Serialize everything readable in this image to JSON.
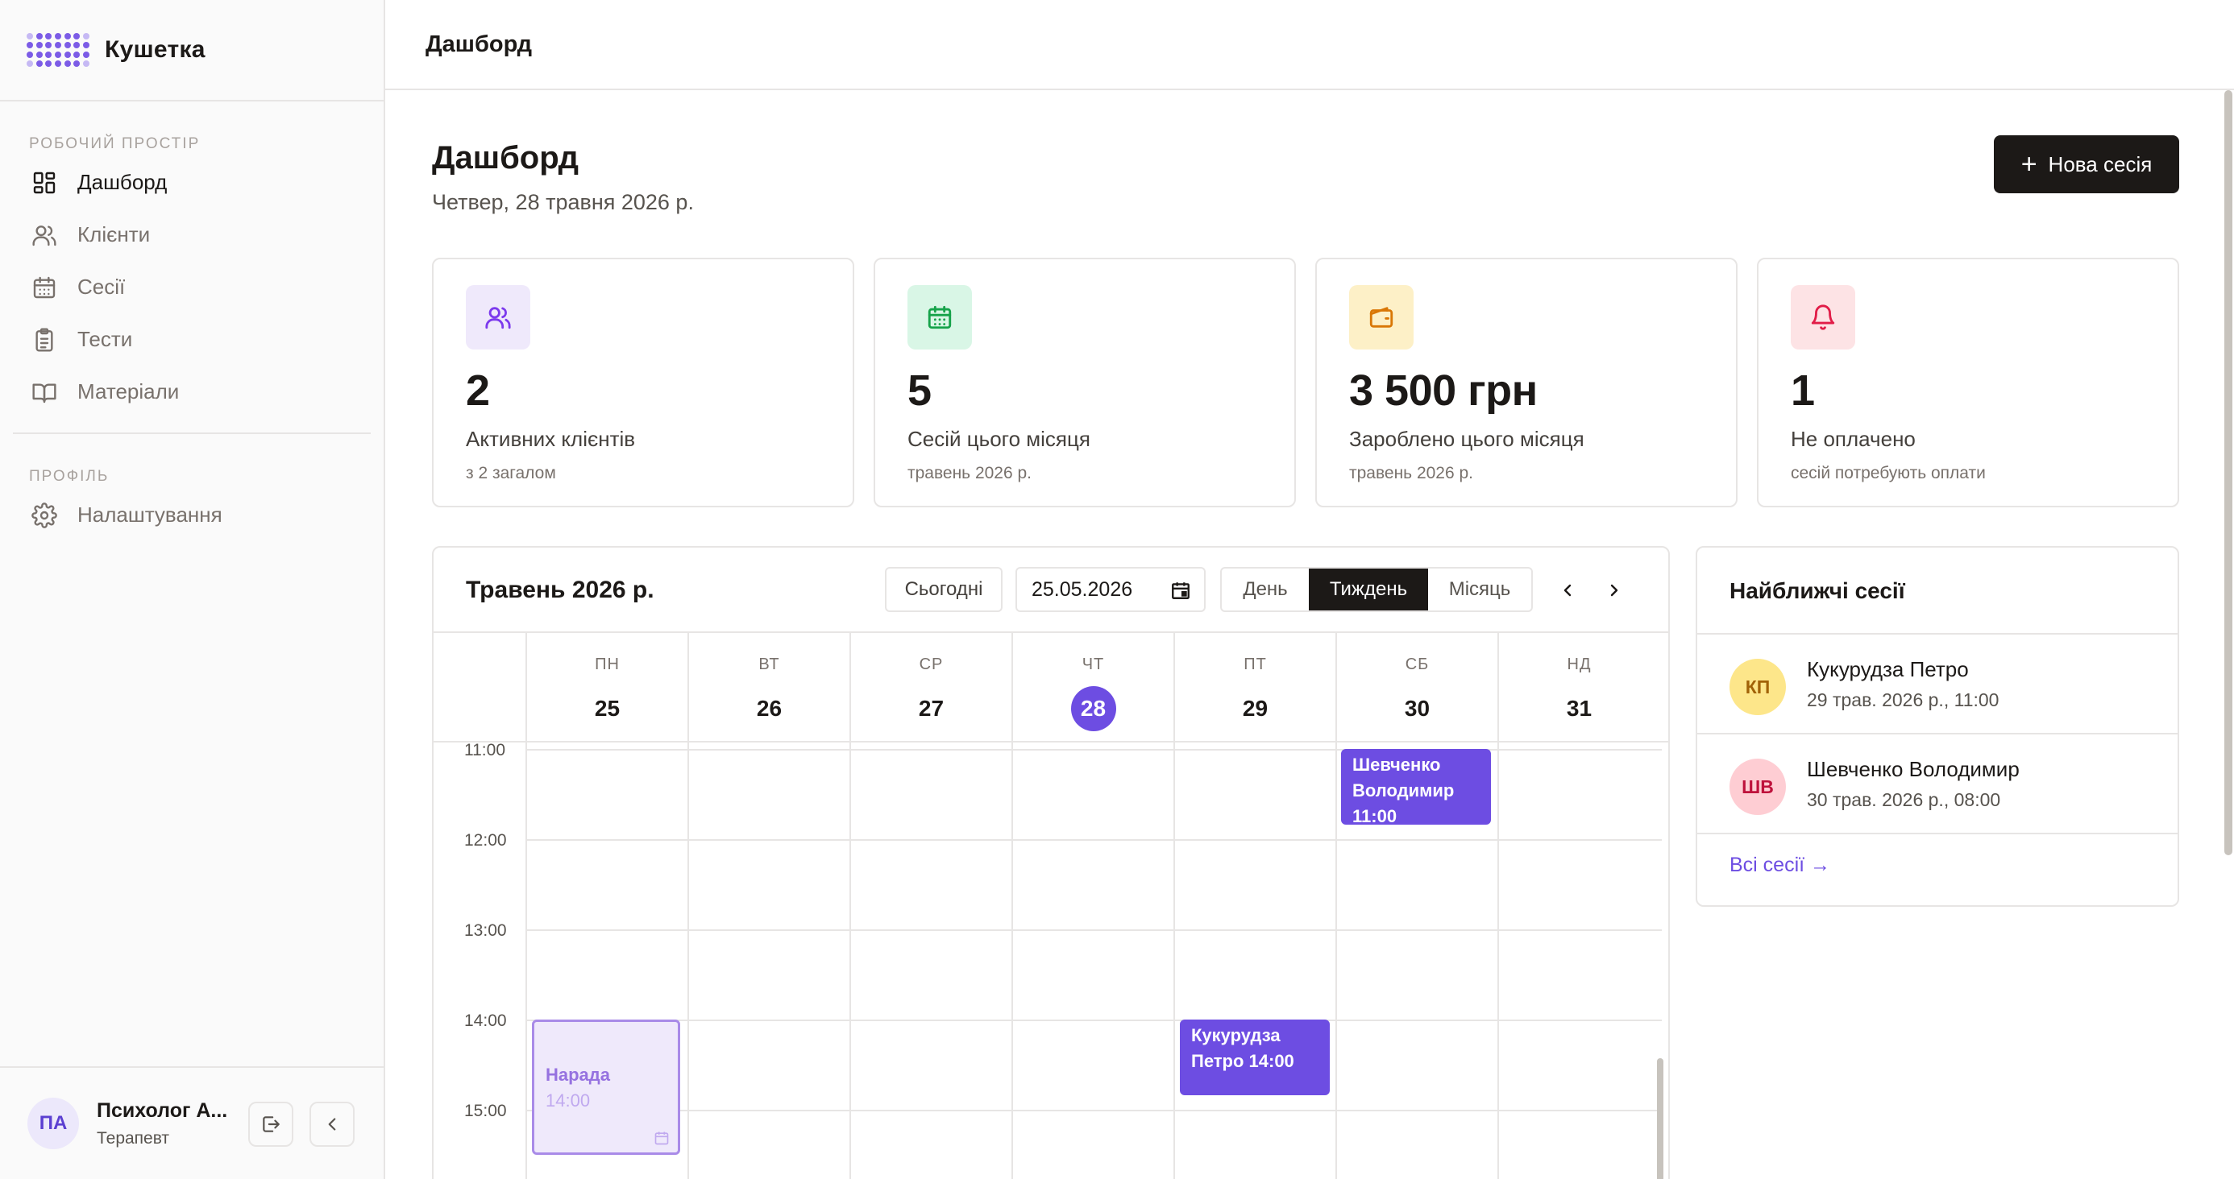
{
  "brand": {
    "name": "Кушетка"
  },
  "sidebar": {
    "workspace_label": "РОБОЧИЙ ПРОСТІР",
    "items": [
      {
        "label": "Дашборд",
        "icon": "grid-icon"
      },
      {
        "label": "Клієнти",
        "icon": "users-icon"
      },
      {
        "label": "Сесії",
        "icon": "calendar-icon"
      },
      {
        "label": "Тести",
        "icon": "clipboard-icon"
      },
      {
        "label": "Матеріали",
        "icon": "book-icon"
      }
    ],
    "profile_label": "ПРОФІЛЬ",
    "settings_label": "Налаштування"
  },
  "user": {
    "initials": "ПА",
    "name": "Психолог А...",
    "role": "Терапевт"
  },
  "topbar": {
    "title": "Дашборд"
  },
  "page": {
    "title": "Дашборд",
    "date": "Четвер, 28 травня 2026 р.",
    "new_session": "Нова сесія"
  },
  "stats": [
    {
      "value": "2",
      "label": "Активних клієнтів",
      "sub": "з 2 загалом"
    },
    {
      "value": "5",
      "label": "Сесій цього місяця",
      "sub": "травень 2026 р."
    },
    {
      "value": "3 500 грн",
      "label": "Зароблено цього місяця",
      "sub": "травень 2026 р."
    },
    {
      "value": "1",
      "label": "Не оплачено",
      "sub": "сесій потребують оплати"
    }
  ],
  "calendar": {
    "title": "Травень 2026 р.",
    "today_btn": "Сьогодні",
    "date_value": "25.05.2026",
    "views": [
      "День",
      "Тиждень",
      "Місяць"
    ],
    "active_view": "Тиждень",
    "days": [
      {
        "name": "ПН",
        "num": "25"
      },
      {
        "name": "ВТ",
        "num": "26"
      },
      {
        "name": "СР",
        "num": "27"
      },
      {
        "name": "ЧТ",
        "num": "28"
      },
      {
        "name": "ПТ",
        "num": "29"
      },
      {
        "name": "СБ",
        "num": "30"
      },
      {
        "name": "НД",
        "num": "31"
      }
    ],
    "hours": [
      "11:00",
      "12:00",
      "13:00",
      "14:00",
      "15:00"
    ],
    "events": {
      "shevchenko": {
        "line1": "Шевченко",
        "line2": "Володимир",
        "time": "11:00"
      },
      "kukurudza": {
        "line1": "Кукурудза",
        "line2": "Петро 14:00"
      },
      "narada": {
        "title": "Нарада",
        "time": "14:00"
      }
    }
  },
  "upcoming": {
    "title": "Найближчі сесії",
    "items": [
      {
        "initials": "КП",
        "name": "Кукурудза Петро",
        "when": "29 трав. 2026 р., 11:00"
      },
      {
        "initials": "ШВ",
        "name": "Шевченко Володимир",
        "when": "30 трав. 2026 р., 08:00"
      }
    ],
    "all_link": "Всі сесії →"
  },
  "colors": {
    "accent": "#6d4de2",
    "stat_icon_bg": [
      "#efe9fb",
      "#d9f6e6",
      "#fdf0c7",
      "#fde3e5"
    ],
    "stat_icon_fg": [
      "#7c3aed",
      "#16a34a",
      "#d97706",
      "#e11d48"
    ],
    "upcoming_avatar_bg": [
      "#fde68a",
      "#fecdd3"
    ],
    "upcoming_avatar_fg": [
      "#a16207",
      "#be123c"
    ]
  }
}
